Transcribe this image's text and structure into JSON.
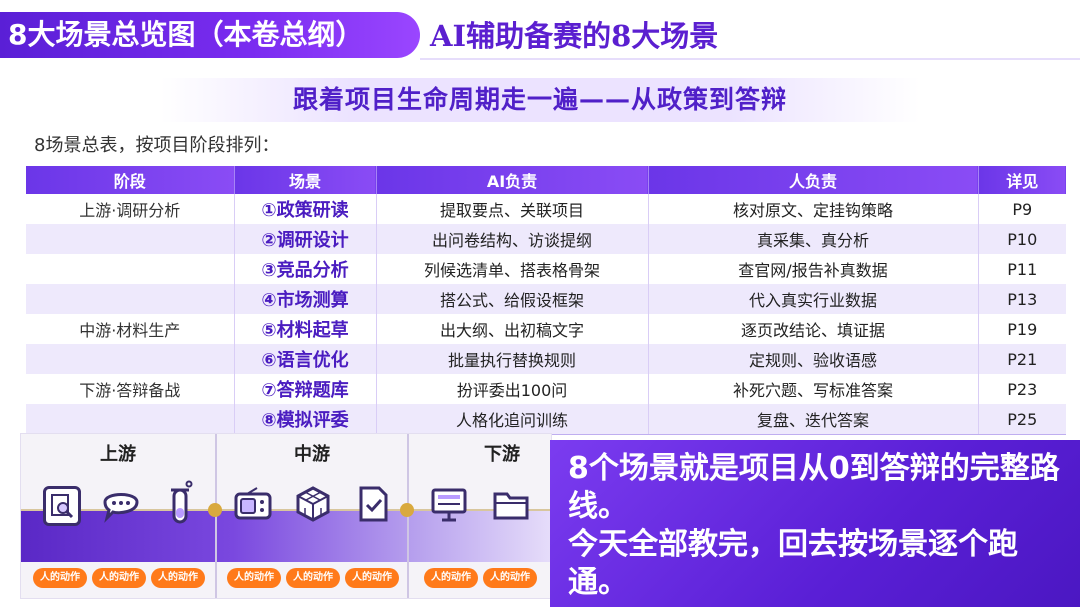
{
  "header": {
    "title": "8大场景总览图（本卷总纲）",
    "subtitle": "AI辅助备赛的8大场景"
  },
  "banner": "跟着项目生命周期走一遍——从政策到答辩",
  "intro": "8场景总表，按项目阶段排列：",
  "table": {
    "headers": [
      "阶段",
      "场景",
      "AI负责",
      "人负责",
      "详见"
    ],
    "rows": [
      {
        "stage": "上游·调研分析",
        "scene": "①政策研读",
        "ai": "提取要点、关联项目",
        "human": "核对原文、定挂钩策略",
        "page": "P9"
      },
      {
        "stage": "",
        "scene": "②调研设计",
        "ai": "出问卷结构、访谈提纲",
        "human": "真采集、真分析",
        "page": "P10"
      },
      {
        "stage": "",
        "scene": "③竞品分析",
        "ai": "列候选清单、搭表格骨架",
        "human": "查官网/报告补真数据",
        "page": "P11"
      },
      {
        "stage": "",
        "scene": "④市场测算",
        "ai": "搭公式、给假设框架",
        "human": "代入真实行业数据",
        "page": "P13"
      },
      {
        "stage": "中游·材料生产",
        "scene": "⑤材料起草",
        "ai": "出大纲、出初稿文字",
        "human": "逐页改结论、填证据",
        "page": "P19"
      },
      {
        "stage": "",
        "scene": "⑥语言优化",
        "ai": "批量执行替换规则",
        "human": "定规则、验收语感",
        "page": "P21"
      },
      {
        "stage": "下游·答辩备战",
        "scene": "⑦答辩题库",
        "ai": "扮评委出100问",
        "human": "补死穴题、写标准答案",
        "page": "P23"
      },
      {
        "stage": "",
        "scene": "⑧模拟评委",
        "ai": "人格化追问训练",
        "human": "复盘、迭代答案",
        "page": "P25"
      }
    ]
  },
  "flow": {
    "segments": [
      {
        "label": "上游",
        "icons": [
          "document-search-icon",
          "chat-bubble-icon",
          "test-tube-icon"
        ],
        "actions": [
          "人的动作",
          "人的动作",
          "人的动作"
        ]
      },
      {
        "label": "中游",
        "icons": [
          "radio-device-icon",
          "cube-icon",
          "document-check-icon"
        ],
        "actions": [
          "人的动作",
          "人的动作",
          "人的动作"
        ]
      },
      {
        "label": "下游",
        "icons": [
          "presentation-board-icon",
          "folder-icon"
        ],
        "actions": [
          "人的动作",
          "人的动作"
        ]
      }
    ]
  },
  "callout": {
    "line1": "8个场景就是项目从0到答辩的完整路线。",
    "line2": "今天全部教完，回去按场景逐个跑通。"
  },
  "colors": {
    "accent_purple": "#5a1fd6",
    "accent_orange": "#ff7a1a",
    "row_tint": "#eee9fc"
  }
}
